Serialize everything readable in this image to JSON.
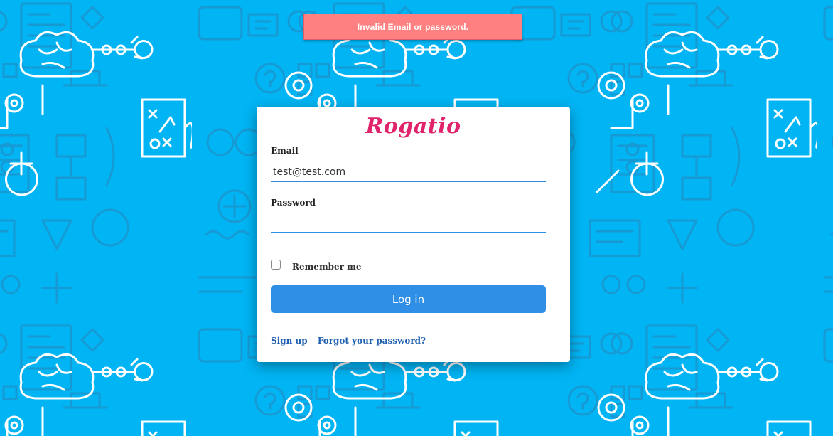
{
  "alert": {
    "message": "Invalid Email or password."
  },
  "brand": {
    "name": "Rogatio"
  },
  "form": {
    "email_label": "Email",
    "email_value": "test@test.com",
    "password_label": "Password",
    "password_value": "",
    "remember_label": "Remember me",
    "remember_checked": false,
    "submit_label": "Log in"
  },
  "links": {
    "sign_up": "Sign up",
    "forgot_password": "Forgot your password?"
  },
  "colors": {
    "background": "#01b4f3",
    "brand": "#e0236a",
    "primary": "#2f8fe6",
    "alert": "#ff8080"
  }
}
